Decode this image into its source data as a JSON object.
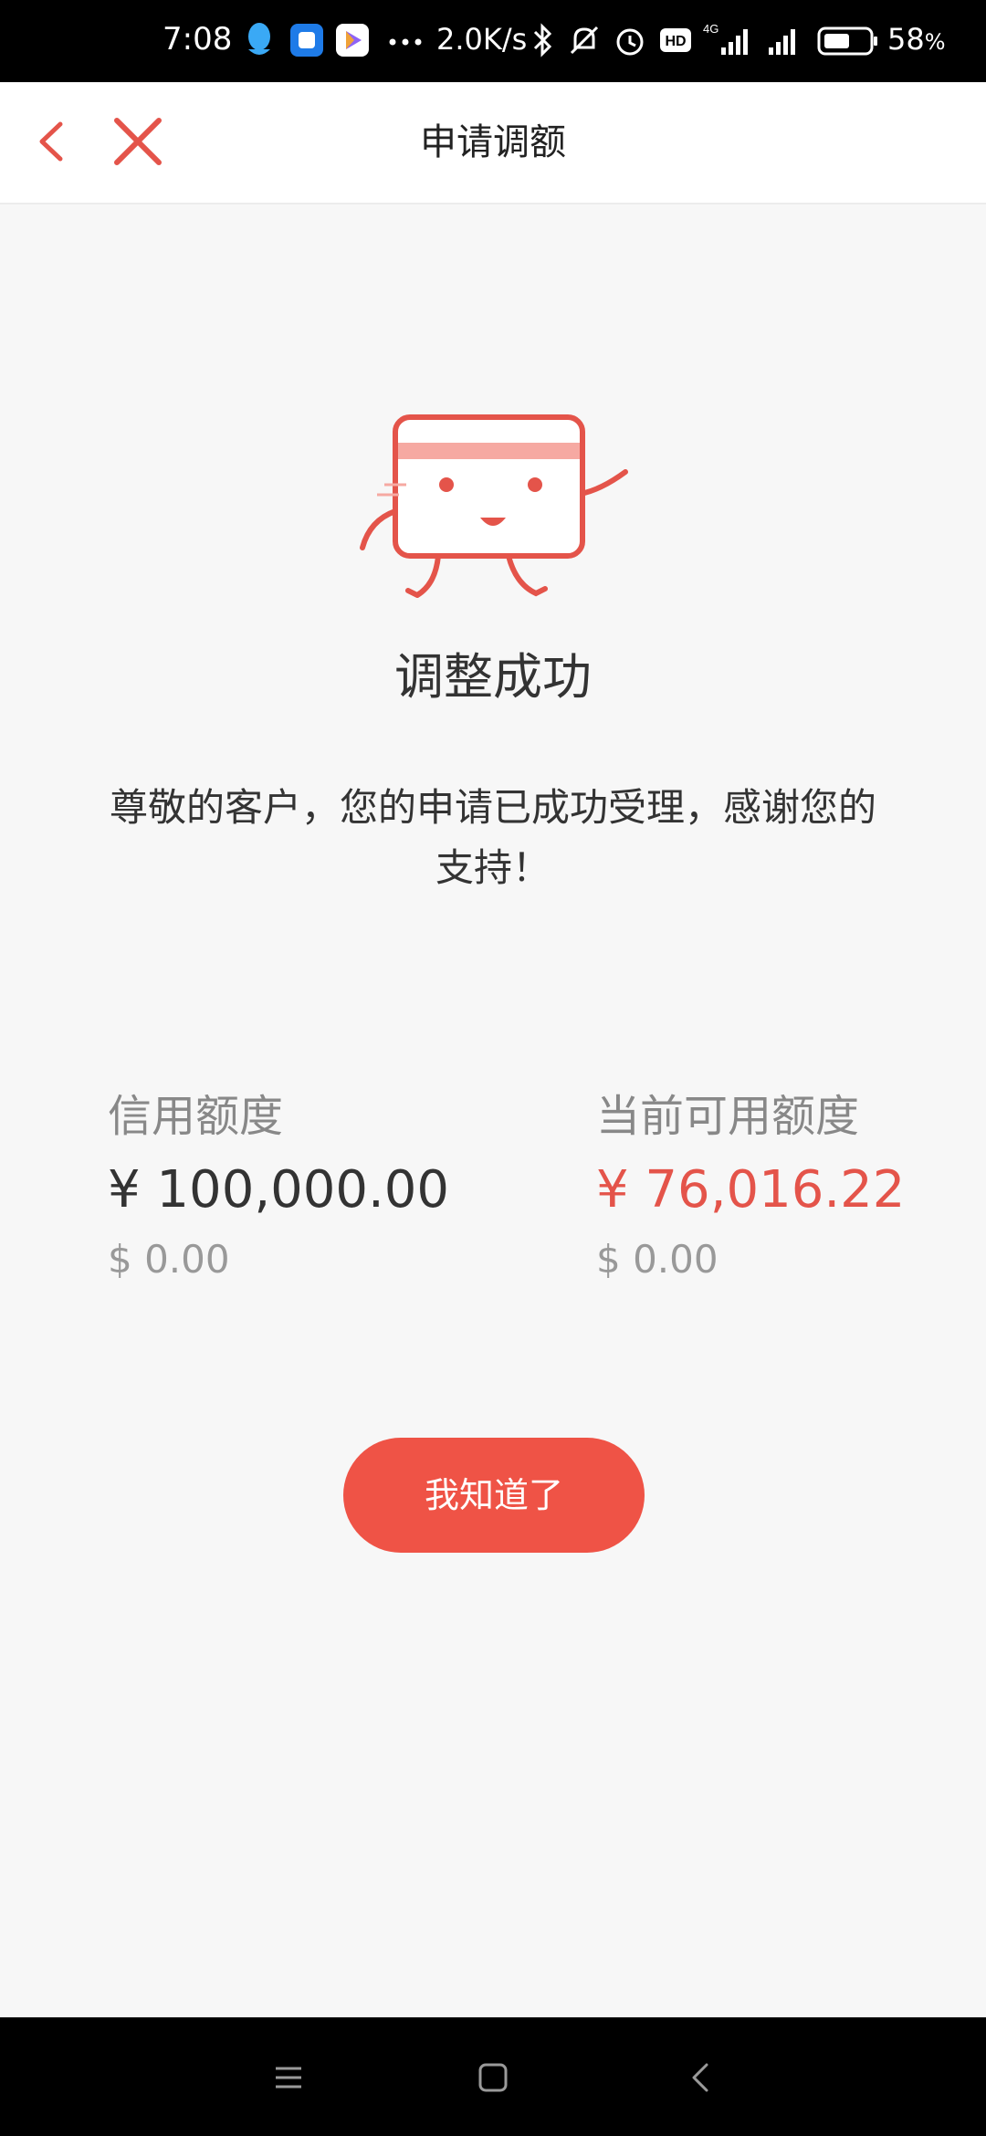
{
  "status_bar": {
    "time": "7:08",
    "network_speed": "2.0K/s",
    "battery": "58",
    "battery_unit": "%",
    "icons": [
      "qq-icon",
      "app-icon",
      "play-store-icon",
      "more-dots-icon",
      "bluetooth-icon",
      "silent-icon",
      "alarm-icon",
      "hd-icon",
      "signal-4g-icon",
      "signal-icon",
      "battery-icon"
    ],
    "network_type": "4G",
    "hd_label": "HD"
  },
  "header": {
    "title": "申请调额",
    "back_icon": "chevron-left-icon",
    "close_icon": "close-icon",
    "accent_color": "#e4544a"
  },
  "result": {
    "mascot_icon": "card-mascot-icon",
    "title": "调整成功",
    "message": "尊敬的客户，您的申请已成功受理，感谢您的支持！"
  },
  "limits": {
    "credit": {
      "label": "信用额度",
      "value": "¥ 100,000.00",
      "usd": "$ 0.00"
    },
    "available": {
      "label": "当前可用额度",
      "value": "¥ 76,016.22",
      "usd": "$ 0.00",
      "color": "#e4544a"
    }
  },
  "confirm_button": {
    "label": "我知道了",
    "color": "#ef5346"
  },
  "nav_bar": {
    "icons": [
      "menu-icon",
      "home-icon",
      "back-icon"
    ]
  }
}
